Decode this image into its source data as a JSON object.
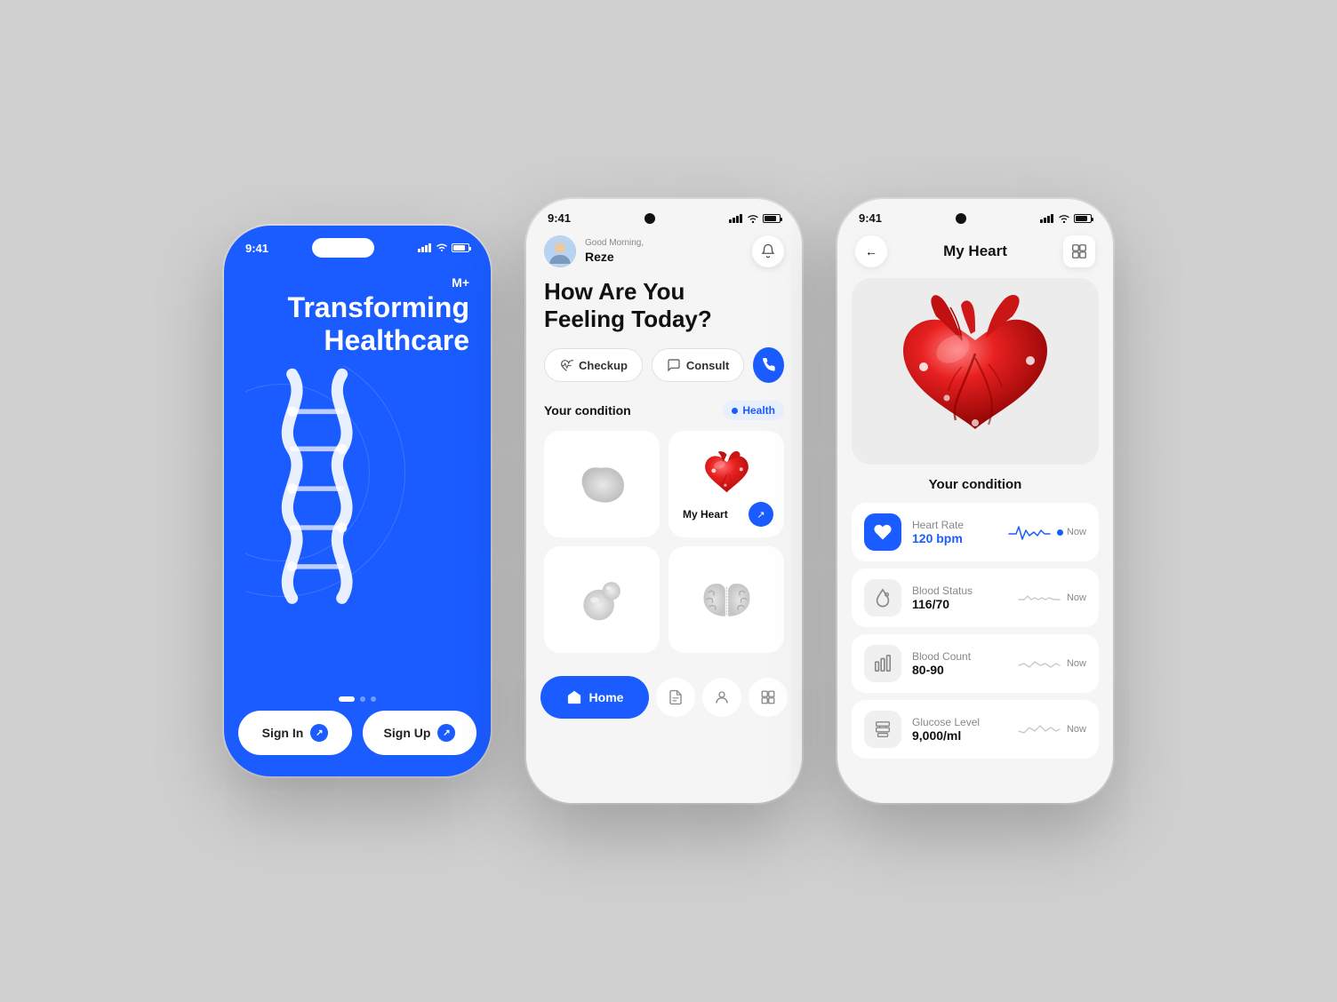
{
  "background": "#d0d0d0",
  "phone1": {
    "status_time": "9:41",
    "logo": "M+",
    "title_line1": "Transforming",
    "title_line2": "Healthcare",
    "btn_signin": "Sign In",
    "btn_signup": "Sign Up"
  },
  "phone2": {
    "status_time": "9:41",
    "greeting": "Good Morning,",
    "user_name": "Reze",
    "feeling_title": "How Are You\nFeeling Today?",
    "feeling_line1": "How Are You",
    "feeling_line2": "Feeling Today?",
    "btn_checkup": "Checkup",
    "btn_consult": "Consult",
    "condition_title": "Your condition",
    "health_label": "Health",
    "organ1_label": "",
    "organ2_label": "My Heart",
    "organ3_label": "",
    "organ4_label": "",
    "nav_home": "Home"
  },
  "phone3": {
    "status_time": "9:41",
    "page_title": "My Heart",
    "condition_title": "Your condition",
    "metrics": [
      {
        "name": "Heart Rate",
        "value": "120 bpm",
        "value_colored": true,
        "now": "Now"
      },
      {
        "name": "Blood Status",
        "value": "116/70",
        "value_colored": false,
        "now": "Now"
      },
      {
        "name": "Blood Count",
        "value": "80-90",
        "value_colored": false,
        "now": "Now"
      },
      {
        "name": "Glucose Level",
        "value": "9,000/ml",
        "value_colored": false,
        "now": "Now"
      }
    ]
  }
}
